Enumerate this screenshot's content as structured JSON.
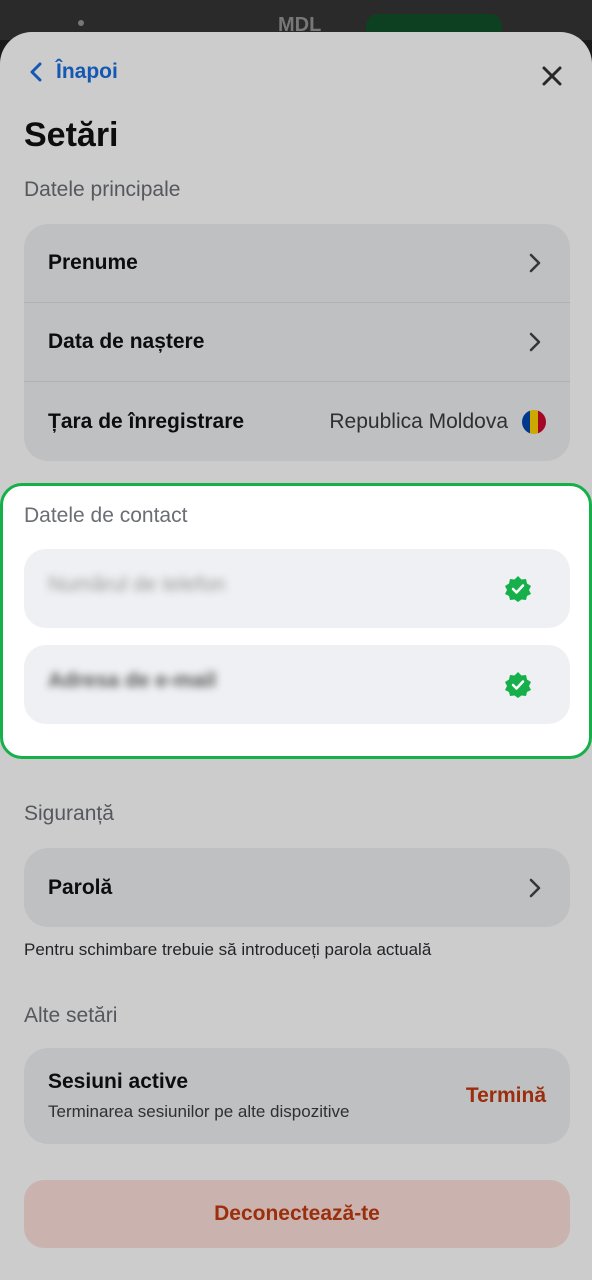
{
  "statusbar": {
    "currency": "MDL"
  },
  "header": {
    "back_label": "Înapoi",
    "title": "Setări"
  },
  "main_section": {
    "heading": "Datele principale",
    "rows": [
      {
        "label": "Prenume"
      },
      {
        "label": "Data de naștere"
      },
      {
        "label": "Țara de înregistrare",
        "value": "Republica Moldova"
      }
    ],
    "flag_colors": [
      "#0046ae",
      "#ffd200",
      "#cc092f"
    ]
  },
  "contact_section": {
    "heading": "Datele de contact",
    "phone_label": "Numărul de telefon",
    "email_label": "Adresa de e-mail",
    "verified_color": "#16b04b"
  },
  "security_section": {
    "heading": "Siguranță",
    "password_label": "Parolă",
    "hint": "Pentru schimbare trebuie să introduceți parola actuală"
  },
  "other_section": {
    "heading": "Alte setări",
    "sessions_title": "Sesiuni active",
    "sessions_sub": "Terminarea sesiunilor pe alte dispozitive",
    "terminate_label": "Termină"
  },
  "logout_label": "Deconectează-te",
  "colors": {
    "accent": "#1b6fe0",
    "danger": "#c23a10",
    "highlight": "#16b04b"
  }
}
